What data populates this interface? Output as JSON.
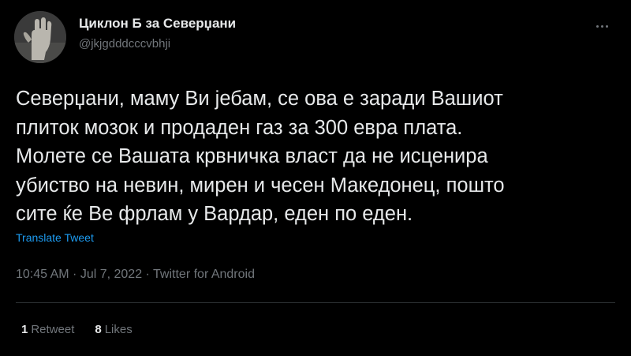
{
  "author": {
    "display_name": "Циклон Б за Северџани",
    "handle": "@jkjgdddcccvbhji"
  },
  "tweet": {
    "lines": [
      "Северџани, маму Ви јебам, се ова е заради Вашиот",
      "плиток мозок и продаден газ за 300 евра плата.",
      "Молете се Вашата крвничка власт да не исценира",
      "убиство на невин, мирен и чесен Македонец, пошто",
      "сите ќе Ве фрлам у Вардар, еден по еден."
    ],
    "translate_label": "Translate Tweet",
    "metadata": "10:45 AM · Jul 7, 2022 · Twitter for Android"
  },
  "stats": {
    "retweets_count": "1",
    "retweets_label": "Retweet",
    "likes_count": "8",
    "likes_label": "Likes"
  },
  "icons": {
    "more": "more-horizontal-icon"
  },
  "colors": {
    "background": "#000000",
    "text": "#e7e9ea",
    "secondary": "#71767b",
    "link": "#1d9bf0",
    "divider": "#2f3336"
  }
}
